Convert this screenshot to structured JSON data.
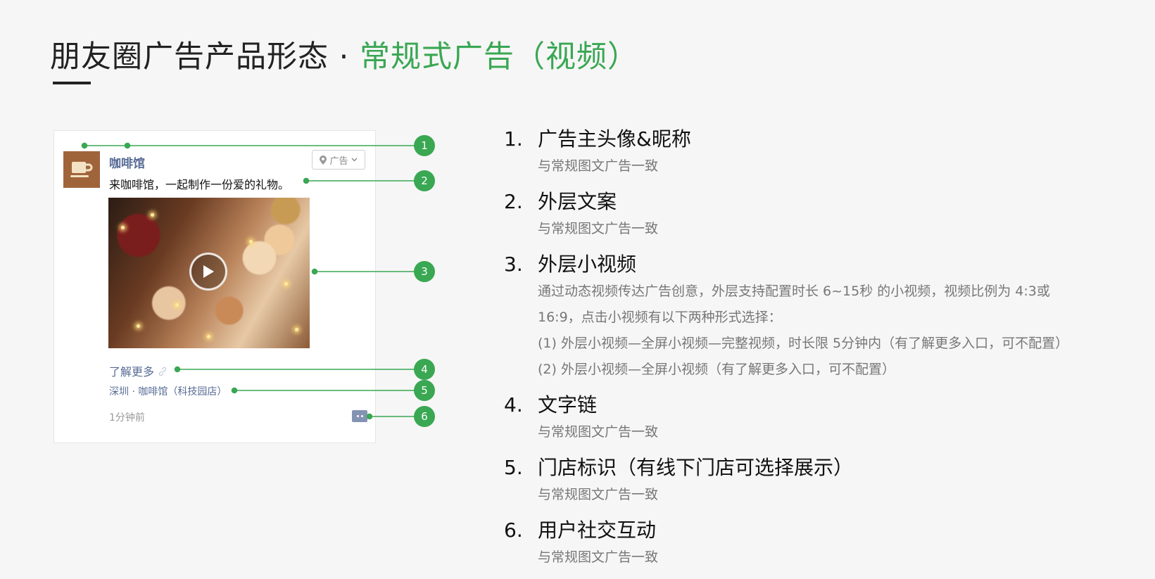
{
  "title": {
    "main": "朋友圈广告产品形态 · ",
    "highlight": "常规式广告（视频）"
  },
  "preview": {
    "nickname": "咖啡馆",
    "ad_tag": "广告",
    "caption": "来咖啡馆，一起制作一份爱的礼物。",
    "link_text": "了解更多",
    "store": "深圳 · 咖啡馆（科技园店）",
    "time": "1分钟前"
  },
  "callouts": [
    "1",
    "2",
    "3",
    "4",
    "5",
    "6"
  ],
  "items": [
    {
      "num": "1.",
      "title": "广告主头像&昵称",
      "desc": [
        "与常规图文广告一致"
      ]
    },
    {
      "num": "2.",
      "title": "外层文案",
      "desc": [
        "与常规图文广告一致"
      ]
    },
    {
      "num": "3.",
      "title": "外层小视频",
      "desc": [
        "通过动态视频传达广告创意，外层支持配置时长 6~15秒 的小视频，视频比例为 4:3或",
        "16:9，点击小视频有以下两种形式选择：",
        "(1) 外层小视频—全屏小视频—完整视频，时长限 5分钟内（有了解更多入口，可不配置）",
        "(2) 外层小视频—全屏小视频（有了解更多入口，可不配置）"
      ]
    },
    {
      "num": "4.",
      "title": "文字链",
      "desc": [
        "与常规图文广告一致"
      ]
    },
    {
      "num": "5.",
      "title": "门店标识（有线下门店可选择展示）",
      "desc": [
        "与常规图文广告一致"
      ]
    },
    {
      "num": "6.",
      "title": "用户社交互动",
      "desc": [
        "与常规图文广告一致"
      ]
    }
  ],
  "colors": {
    "accent": "#3aa753",
    "link": "#576b95",
    "brown": "#a0643b"
  }
}
